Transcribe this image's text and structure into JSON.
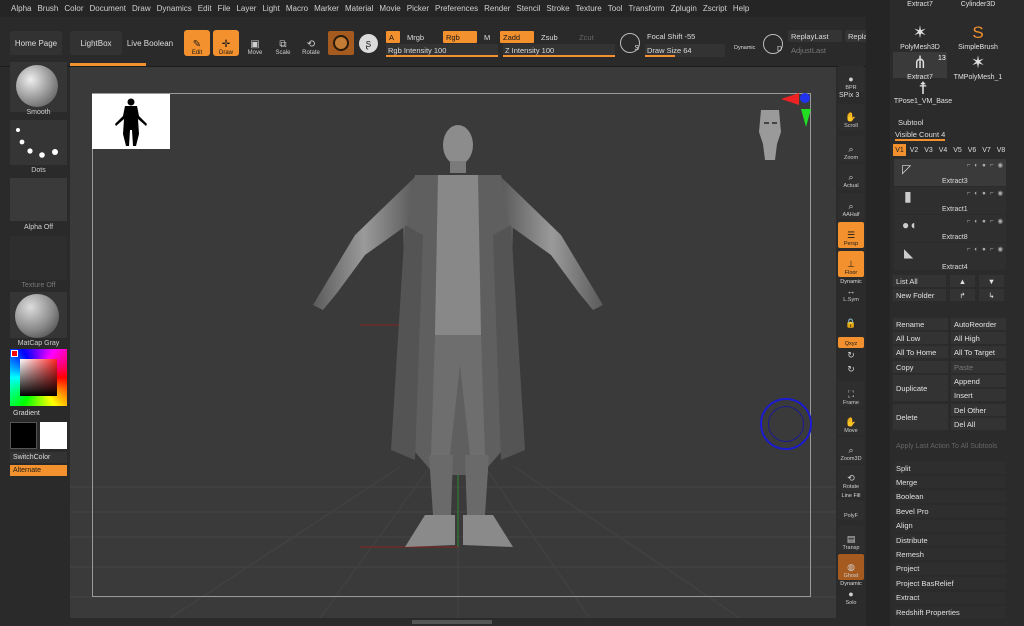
{
  "menu": [
    "Alpha",
    "Brush",
    "Color",
    "Document",
    "Draw",
    "Dynamics",
    "Edit",
    "File",
    "Layer",
    "Light",
    "Macro",
    "Marker",
    "Material",
    "Movie",
    "Picker",
    "Preferences",
    "Render",
    "Stencil",
    "Stroke",
    "Texture",
    "Tool",
    "Transform",
    "Zplugin",
    "Zscript",
    "Help"
  ],
  "topbar": {
    "home_page": "Home Page",
    "lightbox": "LightBox",
    "live_boolean": "Live Boolean",
    "edit": "Edit",
    "draw": "Draw",
    "move": "Move",
    "scale": "Scale",
    "rotate": "Rotate",
    "a_label": "A",
    "mrgb": "Mrgb",
    "rgb": "Rgb",
    "m": "M",
    "zadd": "Zadd",
    "zsub": "Zsub",
    "zcut": "Zcut",
    "rgb_intensity": "Rgb Intensity 100",
    "z_intensity": "Z Intensity 100",
    "focal_shift": "Focal Shift -55",
    "draw_size": "Draw Size 64",
    "dynamic": "Dynamic",
    "replay_last": "ReplayLast",
    "replay": "Repla",
    "adjust_last": "AdjustLast",
    "s_icon_label": "S",
    "d_icon_label": "D",
    "rgb_intensity_value": 100,
    "z_intensity_value": 100,
    "draw_size_value": 64
  },
  "left": {
    "smooth": "Smooth",
    "dots": "Dots",
    "alpha_off": "Alpha Off",
    "texture_off": "Texture Off",
    "matcap": "MatCap Gray",
    "gradient": "Gradient",
    "switch_color": "SwitchColor",
    "alternate": "Alternate"
  },
  "rightbar": {
    "bpr": "BPR",
    "spix": "SPix 3",
    "scroll": "Scroll",
    "zoom": "Zoom",
    "actual": "Actual",
    "aahalf": "AAHalf",
    "persp": "Persp",
    "floor": "Floor",
    "dynamic": "Dynamic",
    "lsym": "L.Sym",
    "xyz": "Qxyz",
    "frame": "Frame",
    "move": "Move",
    "zoom3d": "Zoom3D",
    "rotate": "Rotate",
    "line_fill": "Line Fill",
    "polyf": "PolyF",
    "transp": "Transp",
    "ghost": "Ghost",
    "dynamic2": "Dynamic",
    "solo": "Solo"
  },
  "tray": {
    "brushes": [
      {
        "name": "Extract7"
      },
      {
        "name": "Cylinder3D"
      },
      {
        "name": "PolyMesh3D"
      },
      {
        "name": "SimpleBrush"
      },
      {
        "name": "Extract7"
      },
      {
        "name": "TMPolyMesh_1"
      },
      {
        "name": "TPose1_VM_Base"
      }
    ],
    "badge": "13",
    "subtool_title": "Subtool",
    "visible_count": "Visible Count 4",
    "vtabs": [
      "V1",
      "V2",
      "V3",
      "V4",
      "V5",
      "V6",
      "V7",
      "V8"
    ],
    "subtools": [
      "Extract3",
      "Extract1",
      "Extract8",
      "Extract4"
    ],
    "list_all": "List All",
    "new_folder": "New Folder",
    "rename": "Rename",
    "autoreorder": "AutoReorder",
    "all_low": "All Low",
    "all_high": "All High",
    "all_to_home": "All To Home",
    "all_to_target": "All To Target",
    "copy": "Copy",
    "paste": "Paste",
    "duplicate": "Duplicate",
    "append": "Append",
    "insert": "Insert",
    "delete": "Delete",
    "del_other": "Del Other",
    "del_all": "Del All",
    "apply_last": "Apply Last Action To All Subtools",
    "list": [
      "Split",
      "Merge",
      "Boolean",
      "Bevel Pro",
      "Align",
      "Distribute",
      "Remesh",
      "Project",
      "Project BasRelief",
      "Extract",
      "Redshift Properties"
    ]
  },
  "colors": {
    "accent": "#f2912d",
    "panel": "#2b2b2b",
    "viewport": "#3a3a3a"
  }
}
